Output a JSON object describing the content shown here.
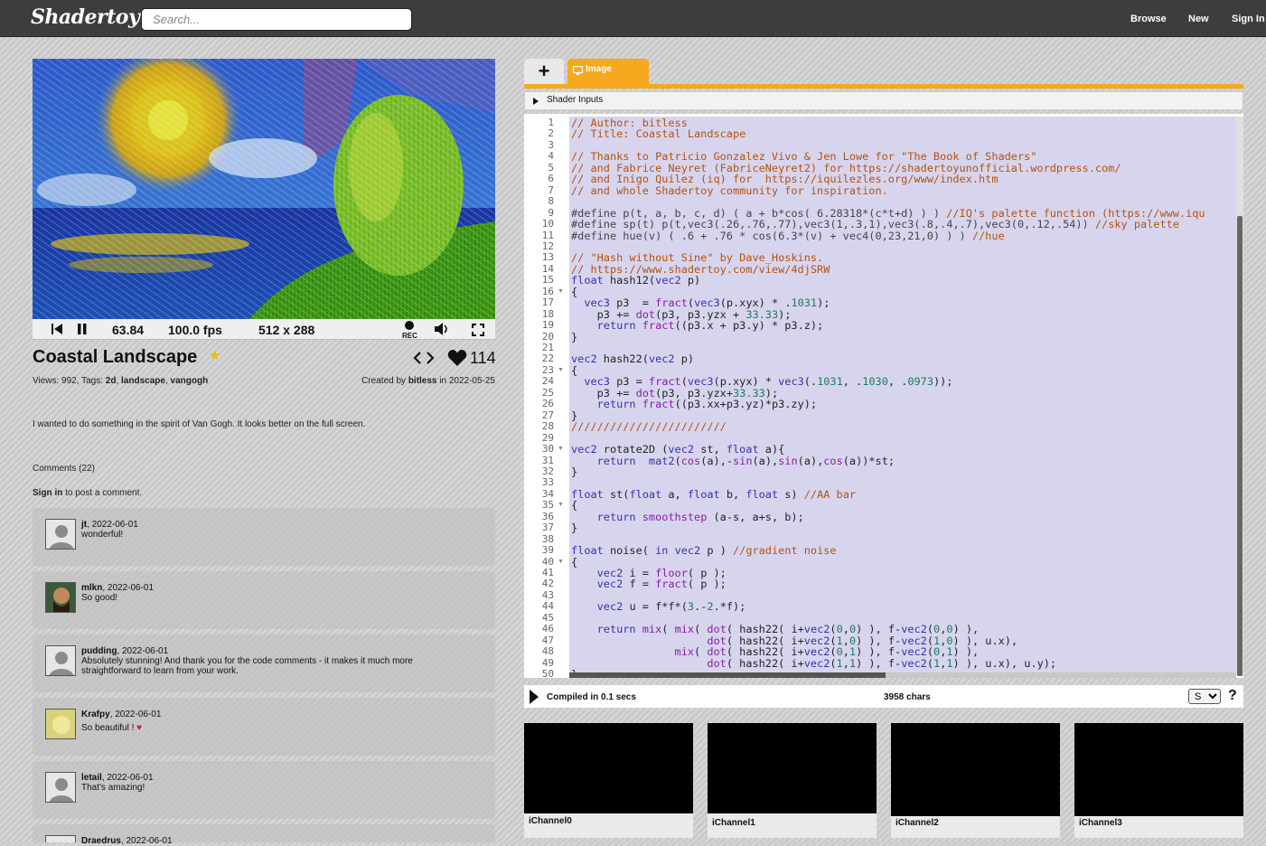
{
  "header": {
    "logo": "Shadertoy",
    "search_placeholder": "Search...",
    "nav": [
      "Browse",
      "New",
      "Sign In"
    ]
  },
  "player": {
    "time": "63.84",
    "fps": "100.0 fps",
    "resolution": "512 x 288",
    "rec_label": "REC"
  },
  "shader": {
    "title": "Coastal Landscape",
    "likes": "114",
    "views_label": "Views: 992, Tags:",
    "tags": [
      "2d",
      "landscape",
      "vangogh"
    ],
    "created_by_label": "Created by",
    "author": "bitless",
    "date_label": "in 2022-05-25",
    "description": "I wanted to do something in the spirit of Van Gogh. It looks better on the full screen."
  },
  "comments_section": {
    "header": "Comments (22)",
    "sign_in": "Sign in",
    "sign_in_suffix": "to post a comment."
  },
  "comments": [
    {
      "user": "jt",
      "date": ", 2022-06-01",
      "text": "wonderful!"
    },
    {
      "user": "mlkn",
      "date": ", 2022-06-01",
      "text": "So good!"
    },
    {
      "user": "pudding",
      "date": ", 2022-06-01",
      "text": "Absolutely stunning! And thank you for the code comments - it makes it much more straightforward to learn from your work."
    },
    {
      "user": "Krafpy",
      "date": ", 2022-06-01",
      "text": "So beautiful !"
    },
    {
      "user": "letail",
      "date": ", 2022-06-01",
      "text": "That's amazing!"
    },
    {
      "user": "Draedrus",
      "date": ", 2022-06-01",
      "text": ""
    }
  ],
  "editor": {
    "tab_add": "+",
    "tab_image": "Image",
    "shader_inputs": "Shader Inputs",
    "compile_status": "Compiled in 0.1 secs",
    "char_count": "3958 chars",
    "font_size_option": "S",
    "help": "?"
  },
  "channels": [
    "iChannel0",
    "iChannel1",
    "iChannel2",
    "iChannel3"
  ],
  "code_lines": [
    "// Author: bitless",
    "// Title: Coastal Landscape",
    "",
    "// Thanks to Patricio Gonzalez Vivo & Jen Lowe for \"The Book of Shaders\"",
    "// and Fabrice Neyret (FabriceNeyret2) for https://shadertoyunofficial.wordpress.com/",
    "// and Inigo Quilez (iq) for  https://iquilezles.org/www/index.htm",
    "// and whole Shadertoy community for inspiration.",
    "",
    "#define p(t, a, b, c, d) ( a + b*cos( 6.28318*(c*t+d) ) ) //IQ's palette function (https://www.iqu",
    "#define sp(t) p(t,vec3(.26,.76,.77),vec3(1,.3,1),vec3(.8,.4,.7),vec3(0,.12,.54)) //sky palette",
    "#define hue(v) ( .6 + .76 * cos(6.3*(v) + vec4(0,23,21,0) ) ) //hue",
    "",
    "// \"Hash without Sine\" by Dave_Hoskins.",
    "// https://www.shadertoy.com/view/4djSRW",
    "float hash12(vec2 p)",
    "{",
    "  vec3 p3  = fract(vec3(p.xyx) * .1031);",
    "    p3 += dot(p3, p3.yzx + 33.33);",
    "    return fract((p3.x + p3.y) * p3.z);",
    "}",
    "",
    "vec2 hash22(vec2 p)",
    "{",
    "  vec3 p3 = fract(vec3(p.xyx) * vec3(.1031, .1030, .0973));",
    "    p3 += dot(p3, p3.yzx+33.33);",
    "    return fract((p3.xx+p3.yz)*p3.zy);",
    "}",
    "////////////////////////",
    "",
    "vec2 rotate2D (vec2 st, float a){",
    "    return  mat2(cos(a),-sin(a),sin(a),cos(a))*st;",
    "}",
    "",
    "float st(float a, float b, float s) //AA bar",
    "{",
    "    return smoothstep (a-s, a+s, b);",
    "}",
    "",
    "float noise( in vec2 p ) //gradient noise",
    "{",
    "    vec2 i = floor( p );",
    "    vec2 f = fract( p );",
    "",
    "    vec2 u = f*f*(3.-2.*f);",
    "",
    "    return mix( mix( dot( hash22( i+vec2(0,0) ), f-vec2(0,0) ),",
    "                     dot( hash22( i+vec2(1,0) ), f-vec2(1,0) ), u.x),",
    "                mix( dot( hash22( i+vec2(0,1) ), f-vec2(0,1) ),",
    "                     dot( hash22( i+vec2(1,1) ), f-vec2(1,1) ), u.x), u.y);",
    "}"
  ]
}
